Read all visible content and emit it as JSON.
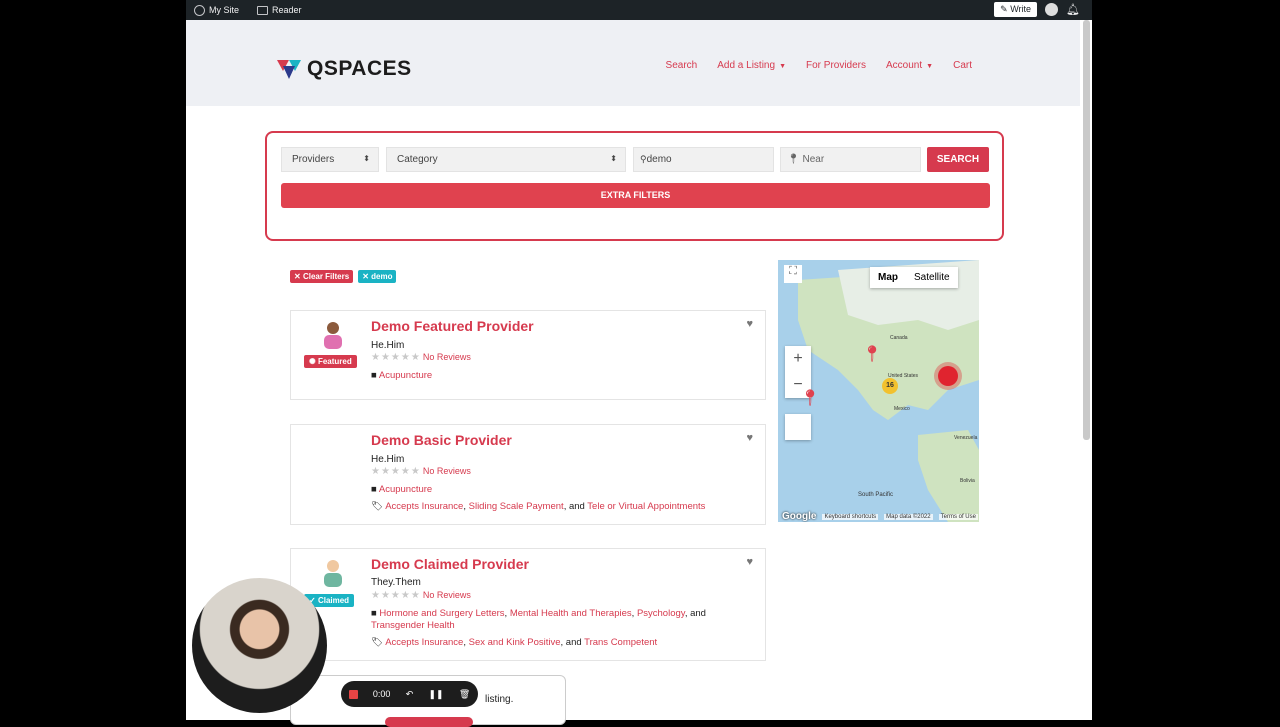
{
  "wpbar": {
    "my_site": "My Site",
    "reader": "Reader",
    "write": "Write"
  },
  "header": {
    "logo": "QSPACES",
    "nav": [
      {
        "label": "Search"
      },
      {
        "label": "Add a Listing"
      },
      {
        "label": "For Providers"
      },
      {
        "label": "Account"
      },
      {
        "label": "Cart"
      }
    ]
  },
  "search": {
    "type_select": "Providers",
    "category_select": "Category",
    "keyword_value": "demo",
    "near_placeholder": "Near",
    "search_button": "SEARCH",
    "extra_filters": "EXTRA FILTERS"
  },
  "chips": {
    "clear": "Clear Filters",
    "demo": "demo"
  },
  "listings": [
    {
      "title": "Demo Featured Provider",
      "pronouns": "He.Him",
      "reviews": "No Reviews",
      "badge": "Featured",
      "categories": "Acupuncture"
    },
    {
      "title": "Demo Basic Provider",
      "pronouns": "He.Him",
      "reviews": "No Reviews",
      "categories": "Acupuncture",
      "tags": [
        "Accepts Insurance",
        "Sliding Scale Payment",
        "Tele or Virtual Appointments"
      ]
    },
    {
      "title": "Demo Claimed Provider",
      "pronouns": "They.Them",
      "reviews": "No Reviews",
      "badge": "Claimed",
      "categories": [
        "Hormone and Surgery Letters",
        "Mental Health and Therapies",
        "Psychology",
        "Transgender Health"
      ],
      "tags": [
        "Accepts Insurance",
        "Sex and Kink Positive",
        "Trans Competent"
      ]
    }
  ],
  "separators": {
    "comma": ",",
    "and": ", and"
  },
  "map": {
    "tab_map": "Map",
    "tab_satellite": "Satellite",
    "zoom_in": "+",
    "zoom_out": "−",
    "cluster_count": "16",
    "labels": {
      "canada": "Canada",
      "us": "United States",
      "mexico": "Mexico",
      "venezuela": "Venezuela",
      "south_pacific": "South Pacific",
      "bolivia": "Bolivia"
    },
    "footer": {
      "google": "Google",
      "shortcuts": "Keyboard shortcuts",
      "data": "Map data ©2022",
      "terms": "Terms of Use"
    }
  },
  "recorder": {
    "time": "0:00"
  },
  "popup": {
    "text": "listing."
  },
  "colors": {
    "accent": "#d63a4e",
    "teal": "#1ab3c4",
    "wpbar": "#1d2327"
  }
}
